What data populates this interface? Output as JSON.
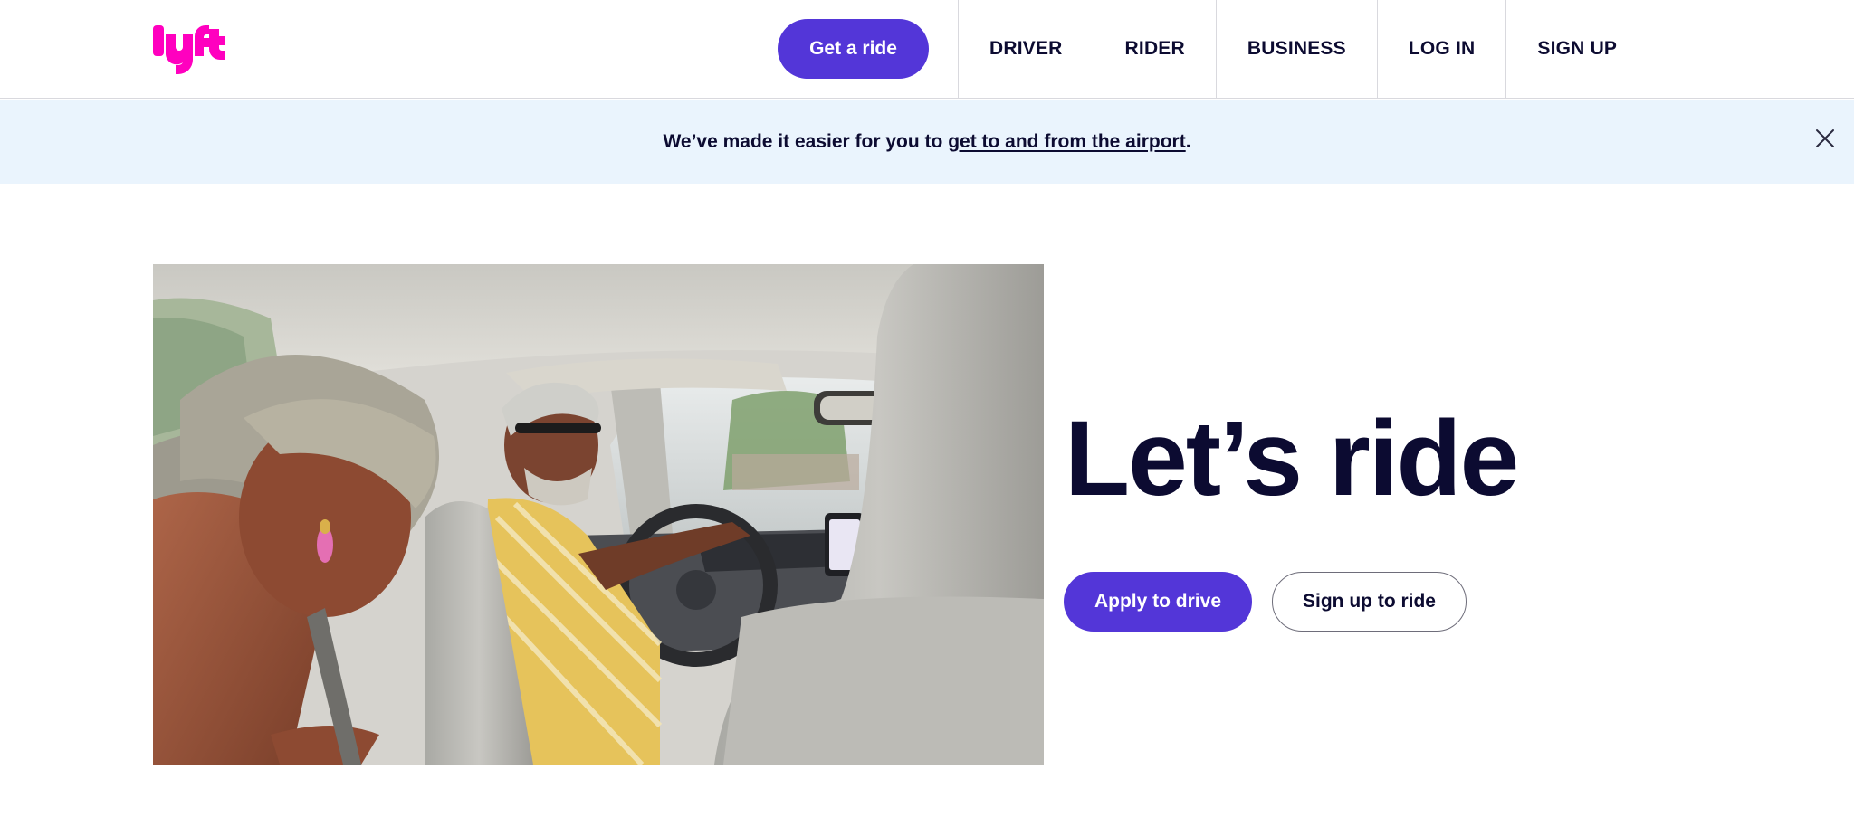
{
  "header": {
    "logo_text": "lyft",
    "get_ride_label": "Get a ride",
    "nav": [
      {
        "label": "DRIVER"
      },
      {
        "label": "RIDER"
      },
      {
        "label": "BUSINESS"
      },
      {
        "label": "LOG IN"
      },
      {
        "label": "SIGN UP"
      }
    ]
  },
  "banner": {
    "text_before": "We’ve made it easier for you to ",
    "link_text": "get to and from the airport",
    "text_after": "."
  },
  "hero": {
    "title": "Let’s ride",
    "apply_label": "Apply to drive",
    "signup_label": "Sign up to ride"
  },
  "colors": {
    "brand_pink": "#ff00bf",
    "primary_purple": "#5336d8",
    "text_dark": "#0c0b31",
    "banner_bg": "#eaf4fd"
  },
  "icons": {
    "close": "close-icon",
    "logo": "lyft-logo"
  }
}
